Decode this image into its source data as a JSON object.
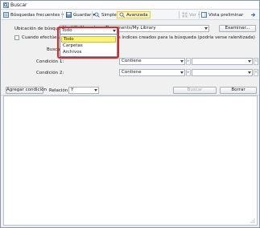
{
  "window": {
    "title": "Buscar",
    "icon": "search-window-icon"
  },
  "toolbar": {
    "frequent_searches": "Búsquedas frecuentes",
    "save": "Guardar",
    "simple": "Simple",
    "advanced": "Avanzada",
    "view": "Ver",
    "preview": "Vista preliminar"
  },
  "search_location": {
    "label": "Ubicación de búsqueda:",
    "value": "file:///C:/Users/user/Documents/My Library",
    "browse_button": "Examinar..."
  },
  "index_option": {
    "checked": false,
    "label": "Cuando efectúe una búsqueda, no utilice los índices creados para la búsqueda (podría verse ralentizada)"
  },
  "search_in": {
    "label": "Buscar:",
    "selected": "Todo",
    "options": [
      "Todo",
      "Carpetas",
      "Archivos"
    ]
  },
  "conditions": [
    {
      "label": "Condición 1:",
      "operator": "Contiene",
      "value": ""
    },
    {
      "label": "Condición 2:",
      "operator": "Contiene",
      "value": ""
    }
  ],
  "actions": {
    "add_condition": "Agregar condición",
    "relation_label": "Relación:",
    "relation_value": "Y",
    "search_button": "Buscar",
    "clear_button": "Borrar"
  },
  "colors": {
    "highlight_border": "#e8231f",
    "selected_option": "#fff37a",
    "active_tab": "#fdf3c6"
  }
}
